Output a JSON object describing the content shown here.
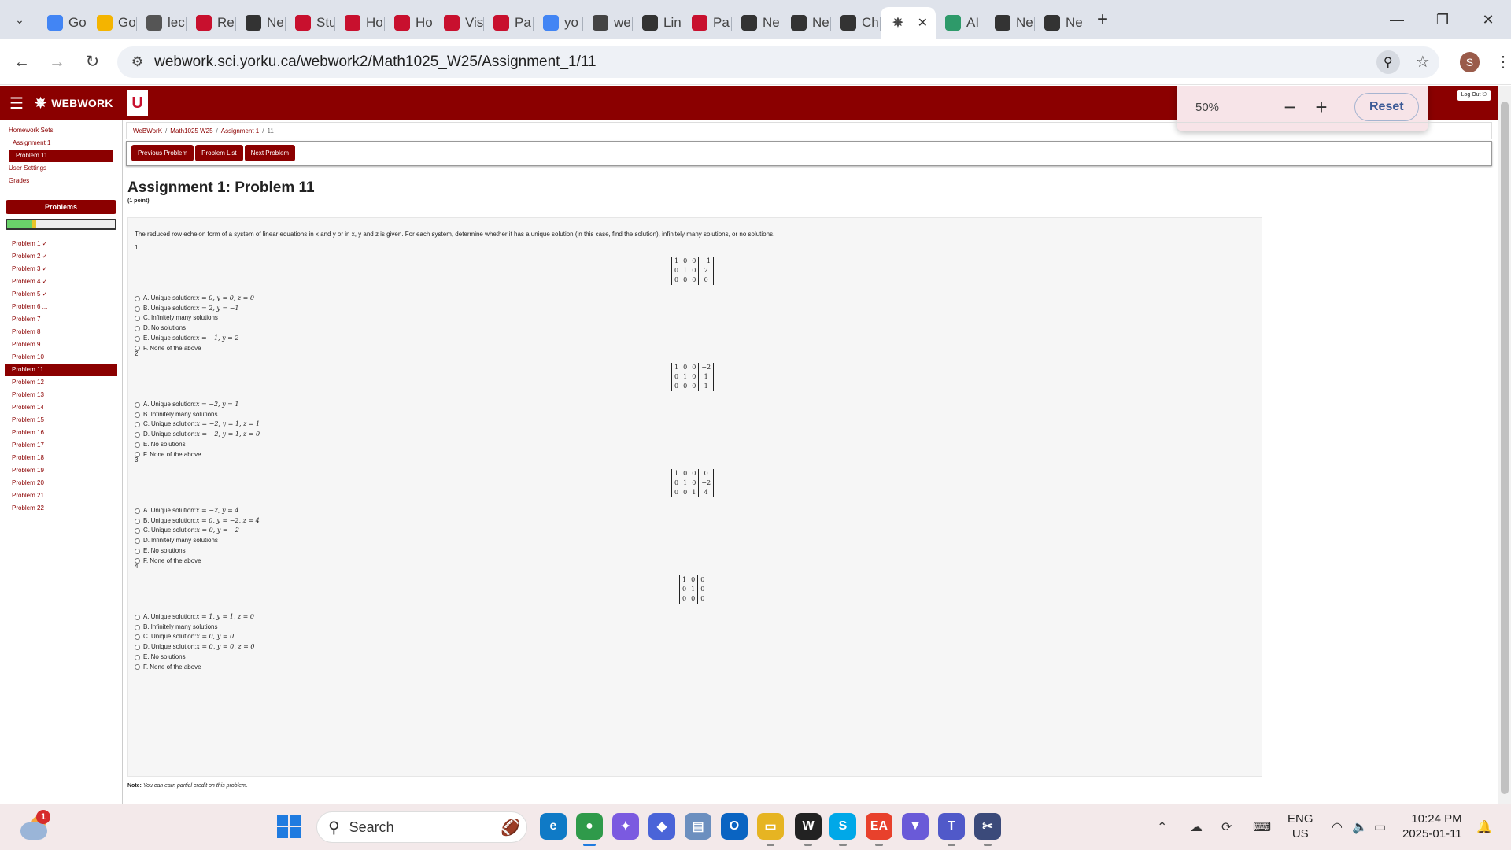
{
  "browser": {
    "tabs": [
      {
        "label": "Go",
        "icon": "google-icon",
        "color": "#4285f4"
      },
      {
        "label": "Go",
        "icon": "slides-icon",
        "color": "#f4b400"
      },
      {
        "label": "lec",
        "icon": "globe-icon",
        "color": "#555555"
      },
      {
        "label": "Re",
        "icon": "york-u-icon",
        "color": "#c8102e"
      },
      {
        "label": "Ne",
        "icon": "chatgpt-icon",
        "color": "#333333"
      },
      {
        "label": "Stu",
        "icon": "york-u-icon",
        "color": "#c8102e"
      },
      {
        "label": "Ho",
        "icon": "my-icon",
        "color": "#c8102e"
      },
      {
        "label": "Ho",
        "icon": "my-icon",
        "color": "#c8102e"
      },
      {
        "label": "Vis",
        "icon": "york-u-icon",
        "color": "#c8102e"
      },
      {
        "label": "Pa",
        "icon": "york-u-icon",
        "color": "#c8102e"
      },
      {
        "label": "yo",
        "icon": "google-icon",
        "color": "#4285f4"
      },
      {
        "label": "we",
        "icon": "webwork-icon",
        "color": "#444444"
      },
      {
        "label": "Lin",
        "icon": "openai-icon",
        "color": "#333333"
      },
      {
        "label": "Pa",
        "icon": "york-u-icon",
        "color": "#c8102e"
      },
      {
        "label": "Ne",
        "icon": "chatgpt-icon",
        "color": "#333333"
      },
      {
        "label": "Ne",
        "icon": "chatgpt-icon",
        "color": "#333333"
      },
      {
        "label": "Ch",
        "icon": "openai-icon",
        "color": "#333333"
      }
    ],
    "active_tab": {
      "icon": "webwork-icon"
    },
    "tabs_after": [
      {
        "label": "AI",
        "icon": "ai-icon",
        "color": "#2e9a6a"
      },
      {
        "label": "Ne",
        "icon": "chatgpt-icon",
        "color": "#333333"
      },
      {
        "label": "Ne",
        "icon": "chatgpt-icon",
        "color": "#333333"
      }
    ],
    "url": "webwork.sci.yorku.ca/webwork2/Math1025_W25/Assignment_1/11",
    "profile_initial": "S",
    "zoom_popup": {
      "level": "50%",
      "reset_label": "Reset"
    }
  },
  "header": {
    "app_name": "WEBWORK",
    "logo_letter": "U",
    "logout_label": "Log Out"
  },
  "sidebar": {
    "links": [
      {
        "label": "Homework Sets",
        "level": "top"
      },
      {
        "label": "Assignment 1",
        "level": "sub"
      },
      {
        "label": "Problem 11",
        "level": "current"
      },
      {
        "label": "User Settings",
        "level": "top"
      },
      {
        "label": "Grades",
        "level": "top"
      }
    ],
    "problems_header": "Problems",
    "progress": {
      "correct_fraction": 0.23,
      "partial_fraction": 0.04
    },
    "problems": [
      "Problem 1 ✓",
      "Problem 2 ✓",
      "Problem 3 ✓",
      "Problem 4 ✓",
      "Problem 5 ✓",
      "Problem 6 ...",
      "Problem 7",
      "Problem 8",
      "Problem 9",
      "Problem 10",
      "Problem 11",
      "Problem 12",
      "Problem 13",
      "Problem 14",
      "Problem 15",
      "Problem 16",
      "Problem 17",
      "Problem 18",
      "Problem 19",
      "Problem 20",
      "Problem 21",
      "Problem 22"
    ],
    "current_problem_index": 10
  },
  "breadcrumb": [
    "WeBWorK",
    "Math1025 W25",
    "Assignment 1",
    "11"
  ],
  "nav_buttons": [
    "Previous Problem",
    "Problem List",
    "Next Problem"
  ],
  "problem": {
    "title": "Assignment 1: Problem 11",
    "points": "(1 point)",
    "intro": "The reduced row echelon form of a system of linear equations in x and y or in x, y and z is given. For each system, determine whether it has a unique solution (in this case, find the solution), infinitely many solutions, or no solutions.",
    "parts": [
      {
        "number": "1.",
        "matrix": [
          [
            "1",
            "0",
            "0",
            "−1"
          ],
          [
            "0",
            "1",
            "0",
            "2"
          ],
          [
            "0",
            "0",
            "0",
            "0"
          ]
        ],
        "choices": [
          {
            "letter": "A.",
            "text": "Unique solution:",
            "math": " x = 0, y = 0, z = 0"
          },
          {
            "letter": "B.",
            "text": "Unique solution:",
            "math": " x = 2, y = −1"
          },
          {
            "letter": "C.",
            "text": "Infinitely many solutions",
            "math": ""
          },
          {
            "letter": "D.",
            "text": "No solutions",
            "math": ""
          },
          {
            "letter": "E.",
            "text": "Unique solution:",
            "math": "x = −1, y = 2"
          },
          {
            "letter": "F.",
            "text": "None of the above",
            "math": ""
          }
        ]
      },
      {
        "number": "2.",
        "matrix": [
          [
            "1",
            "0",
            "0",
            "−2"
          ],
          [
            "0",
            "1",
            "0",
            "1"
          ],
          [
            "0",
            "0",
            "0",
            "1"
          ]
        ],
        "choices": [
          {
            "letter": "A.",
            "text": "Unique solution:",
            "math": " x = −2, y = 1"
          },
          {
            "letter": "B.",
            "text": "Infinitely many solutions",
            "math": ""
          },
          {
            "letter": "C.",
            "text": "Unique solution:",
            "math": " x = −2, y = 1, z = 1"
          },
          {
            "letter": "D.",
            "text": "Unique solution:",
            "math": " x = −2, y = 1, z = 0"
          },
          {
            "letter": "E.",
            "text": "No solutions",
            "math": ""
          },
          {
            "letter": "F.",
            "text": "None of the above",
            "math": ""
          }
        ]
      },
      {
        "number": "3.",
        "matrix": [
          [
            "1",
            "0",
            "0",
            "0"
          ],
          [
            "0",
            "1",
            "0",
            "−2"
          ],
          [
            "0",
            "0",
            "1",
            "4"
          ]
        ],
        "choices": [
          {
            "letter": "A.",
            "text": "Unique solution:",
            "math": " x = −2, y = 4"
          },
          {
            "letter": "B.",
            "text": "Unique solution:",
            "math": " x = 0, y = −2, z = 4"
          },
          {
            "letter": "C.",
            "text": "Unique solution:",
            "math": " x = 0, y = −2"
          },
          {
            "letter": "D.",
            "text": "Infinitely many solutions",
            "math": ""
          },
          {
            "letter": "E.",
            "text": "No solutions",
            "math": ""
          },
          {
            "letter": "F.",
            "text": "None of the above",
            "math": ""
          }
        ]
      },
      {
        "number": "4.",
        "matrix": [
          [
            "1",
            "0",
            "0"
          ],
          [
            "0",
            "1",
            "0"
          ],
          [
            "0",
            "0",
            "0"
          ]
        ],
        "choices": [
          {
            "letter": "A.",
            "text": "Unique solution:",
            "math": " x = 1, y = 1, z = 0"
          },
          {
            "letter": "B.",
            "text": "Infinitely many solutions",
            "math": ""
          },
          {
            "letter": "C.",
            "text": "Unique solution:",
            "math": " x = 0, y = 0"
          },
          {
            "letter": "D.",
            "text": "Unique solution:",
            "math": " x = 0, y = 0, z = 0"
          },
          {
            "letter": "E.",
            "text": "No solutions",
            "math": ""
          },
          {
            "letter": "F.",
            "text": "None of the above",
            "math": ""
          }
        ]
      }
    ],
    "note_label": "Note:",
    "note_text": "You can earn partial credit on this problem."
  },
  "taskbar": {
    "weather_badge": "1",
    "search_placeholder": "Search",
    "apps": [
      {
        "name": "edge-icon",
        "color": "#0f7ac6",
        "glyph": "e"
      },
      {
        "name": "chrome-icon",
        "color": "#2f9a4a",
        "glyph": "●"
      },
      {
        "name": "copilot-icon",
        "color": "#7b5ae0",
        "glyph": "✦"
      },
      {
        "name": "m365-icon",
        "color": "#4a64d8",
        "glyph": "◆"
      },
      {
        "name": "files-icon",
        "color": "#6c8fbf",
        "glyph": "▤"
      },
      {
        "name": "outlook-icon",
        "color": "#0a64c2",
        "glyph": "O"
      },
      {
        "name": "file-explorer-icon",
        "color": "#e6b422",
        "glyph": "▭"
      },
      {
        "name": "webwork-app-icon",
        "color": "#222222",
        "glyph": "W"
      },
      {
        "name": "skype-icon",
        "color": "#00a8e8",
        "glyph": "S"
      },
      {
        "name": "ea-icon",
        "color": "#e8412c",
        "glyph": "EA"
      },
      {
        "name": "vpn-icon",
        "color": "#6a5ad8",
        "glyph": "▼"
      },
      {
        "name": "teams-icon",
        "color": "#5059c9",
        "glyph": "T"
      },
      {
        "name": "snipping-icon",
        "color": "#3b4a7a",
        "glyph": "✂"
      }
    ],
    "lang_line1": "ENG",
    "lang_line2": "US",
    "time": "10:24 PM",
    "date": "2025-01-11"
  }
}
